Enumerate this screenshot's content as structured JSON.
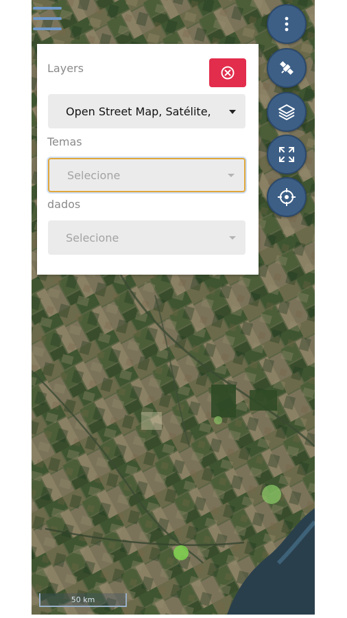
{
  "panel": {
    "layers_label": "Layers",
    "layers_value": "Open Street Map, Satélite,",
    "temas_label": "Temas",
    "temas_placeholder": "Selecione",
    "dados_label": "dados",
    "dados_placeholder": "Selecione"
  },
  "map": {
    "basemap": "satellite",
    "scale_label": "50 km"
  },
  "controls": [
    "more-options",
    "satellite",
    "layers",
    "fullscreen",
    "locate"
  ],
  "colors": {
    "close_button": "#e22d4c",
    "control_blue": "#3d5f86",
    "focus_border": "#e0a63a"
  }
}
